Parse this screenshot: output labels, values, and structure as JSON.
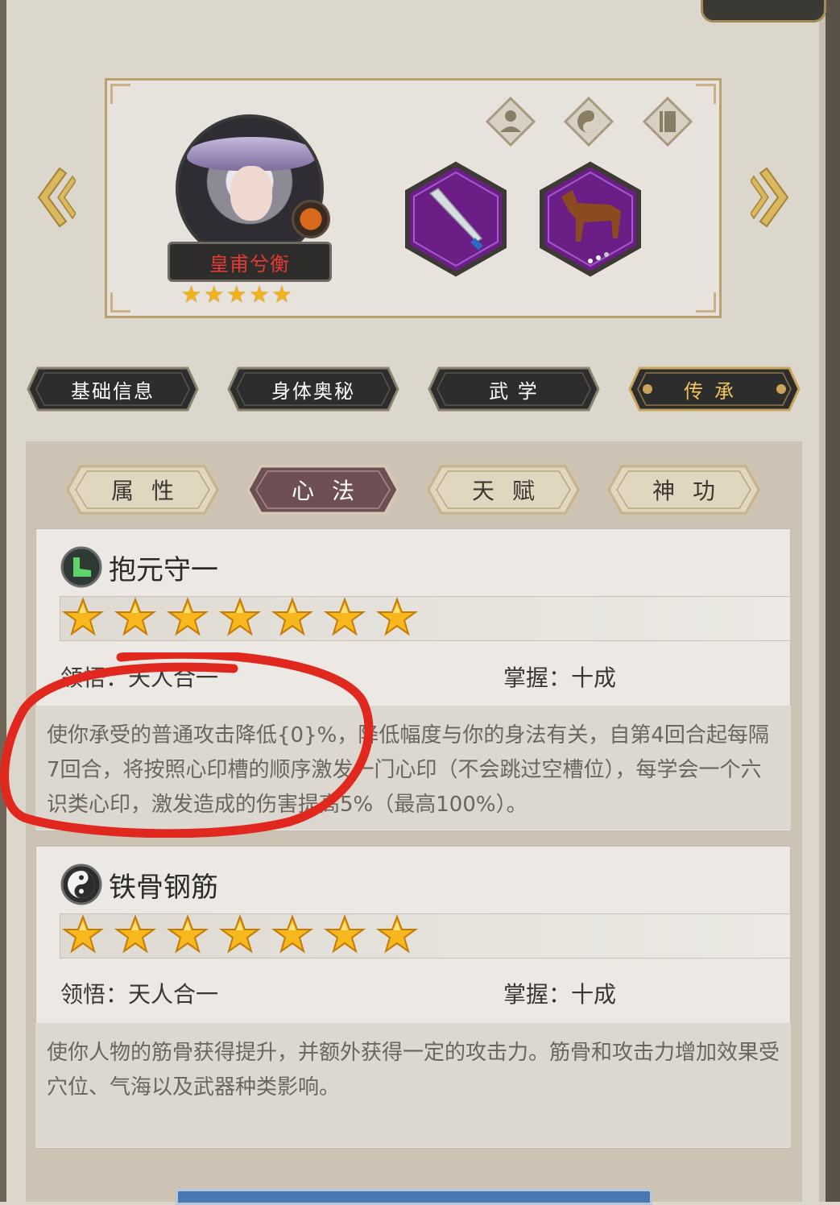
{
  "hero": {
    "name": "皇甫兮衡",
    "star_rating": 5,
    "equipment": [
      "sword",
      "horse"
    ],
    "icons": [
      "person-icon",
      "yin-yang-icon",
      "book-icon"
    ]
  },
  "main_tabs": [
    {
      "label": "基础信息"
    },
    {
      "label": "身体奥秘"
    },
    {
      "label": "武 学"
    },
    {
      "label": "传承"
    }
  ],
  "sub_tabs": [
    {
      "label": "属性"
    },
    {
      "label": "心法"
    },
    {
      "label": "天赋"
    },
    {
      "label": "神功"
    }
  ],
  "skills": [
    {
      "name": "抱元守一",
      "stars": 7,
      "comprehension": "领悟：天人合一",
      "mastery": "掌握：十成",
      "description": "使你承受的普通攻击降低{0}%，降低幅度与你的身法有关，自第4回合起每隔7回合，将按照心印槽的顺序激发一门心印（不会跳过空槽位），每学会一个六识类心印，激发造成的伤害提高5%（最高100%）。"
    },
    {
      "name": "铁骨钢筋",
      "stars": 7,
      "comprehension": "领悟：天人合一",
      "mastery": "掌握：十成",
      "description": "使你人物的筋骨获得提升，并额外获得一定的攻击力。筋骨和攻击力增加效果受穴位、气海以及武器种类影响。"
    }
  ],
  "colors": {
    "accent_gold": "#f0c35e",
    "hero_name": "#e23b33",
    "annotation_red": "#e0281f",
    "active_subtab": "#6e4f54"
  }
}
